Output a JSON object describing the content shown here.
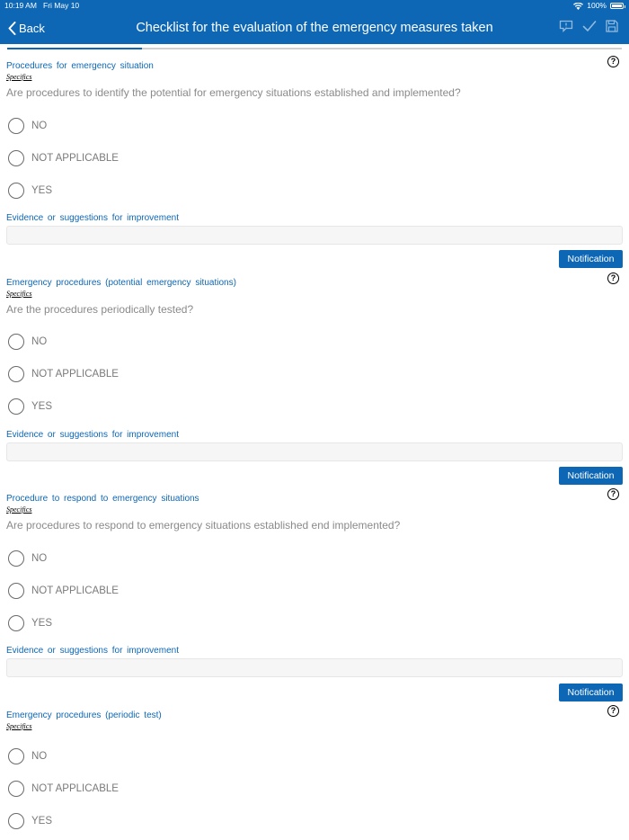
{
  "status_bar": {
    "time": "10:19 AM",
    "date": "Fri May 10",
    "battery": "100%"
  },
  "header": {
    "back_label": "Back",
    "title": "Checklist for the evaluation of the emergency measures taken",
    "icons": [
      "comment-icon",
      "check-icon",
      "save-icon"
    ]
  },
  "progress": 0.22,
  "colors": {
    "accent": "#0d67b5",
    "question_gray": "#8a8a8a",
    "input_bg": "#f6f6f6"
  },
  "sections": [
    {
      "title": "Procedures for emergency situation",
      "specifics": "Specifics",
      "question": "Are procedures to identify the potential for emergency situations established and implemented?",
      "options": [
        "NO",
        "NOT APPLICABLE",
        "YES"
      ],
      "evidence_label": "Evidence or suggestions for improvement",
      "evidence_value": "",
      "notification_label": "Notification"
    },
    {
      "title": "Emergency procedures (potential emergency situations)",
      "specifics": "Specifics",
      "question": "Are the procedures periodically tested?",
      "options": [
        "NO",
        "NOT APPLICABLE",
        "YES"
      ],
      "evidence_label": "Evidence or suggestions for improvement",
      "evidence_value": "",
      "notification_label": "Notification"
    },
    {
      "title": "Procedure to respond to emergency situations",
      "specifics": "Specifics",
      "question": "Are procedures to respond to emergency situations established end implemented?",
      "options": [
        "NO",
        "NOT APPLICABLE",
        "YES"
      ],
      "evidence_label": "Evidence or suggestions for improvement",
      "evidence_value": "",
      "notification_label": "Notification"
    },
    {
      "title": "Emergency procedures (periodic test)",
      "specifics": "Specifics",
      "question": "",
      "options": [
        "NO",
        "NOT APPLICABLE",
        "YES"
      ]
    }
  ]
}
